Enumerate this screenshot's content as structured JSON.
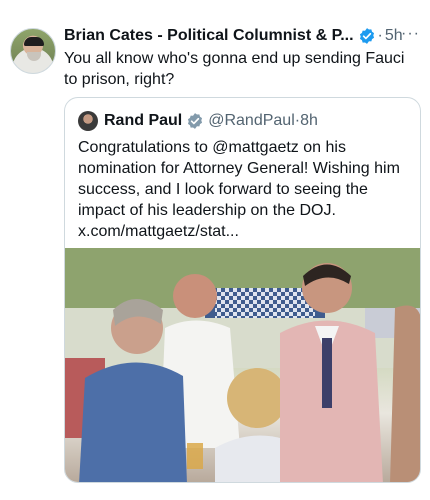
{
  "tweet": {
    "author_name": "Brian Cates - Political Columnist & P...",
    "dot": "·",
    "time": "5h",
    "more": "···",
    "text": "You all know who's gonna end up sending Fauci to prison, right?"
  },
  "quote": {
    "author_name": "Rand Paul",
    "handle": "@RandPaul",
    "dot": "·",
    "time": "8h",
    "text": "Congratulations to @mattgaetz on his nomination for Attorney General! Wishing him success, and I look forward to seeing the impact of his leadership on the DOJ. x.com/mattgaetz/stat..."
  },
  "colors": {
    "verified_blue": "#1d9bf0",
    "verified_gray": "#829aab"
  }
}
